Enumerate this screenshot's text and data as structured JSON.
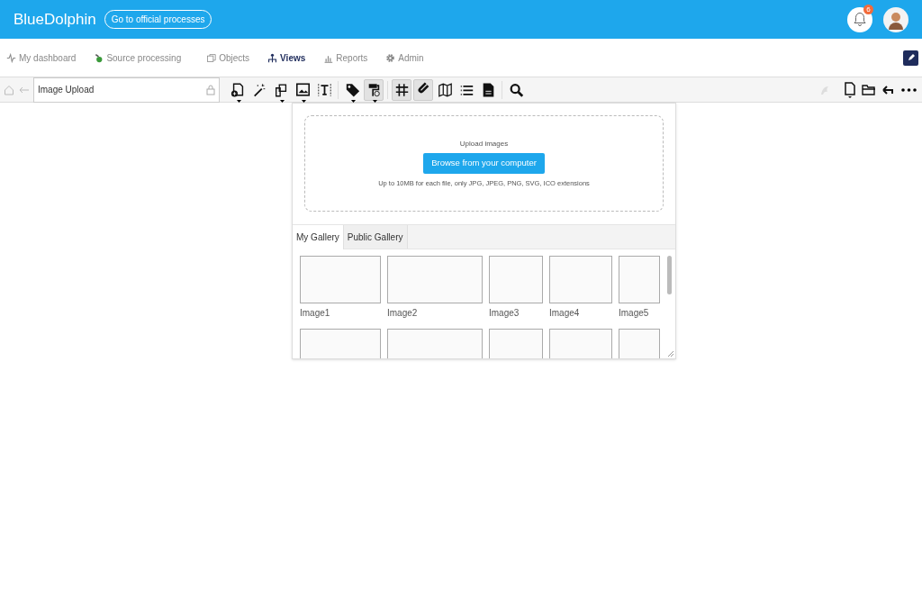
{
  "header": {
    "logo": "BlueDolphin",
    "process_link": "Go to official processes",
    "notification_count": "6"
  },
  "nav": [
    {
      "label": "My dashboard",
      "selected": false
    },
    {
      "label": "Source processing",
      "selected": false
    },
    {
      "label": "Objects",
      "selected": false
    },
    {
      "label": "Views",
      "selected": true
    },
    {
      "label": "Reports",
      "selected": false
    },
    {
      "label": "Admin",
      "selected": false
    }
  ],
  "toolbar": {
    "view_name": "Image Upload",
    "tools": [
      {
        "pressed": false
      },
      {
        "pressed": false
      },
      {
        "pressed": false
      },
      {
        "pressed": false
      },
      {
        "pressed": false
      },
      {
        "pressed": false
      },
      {
        "pressed": true
      },
      {
        "pressed": true
      },
      {
        "pressed": true
      },
      {
        "pressed": false
      },
      {
        "pressed": false
      },
      {
        "pressed": false
      },
      {
        "pressed": false
      }
    ]
  },
  "upload_panel": {
    "title": "Upload images",
    "button": "Browse from your computer",
    "hint": "Up to 10MB for each file, only JPG, JPEG, PNG, SVG, ICO extensions",
    "tabs": [
      {
        "label": "My Gallery",
        "selected": true
      },
      {
        "label": "Public Gallery",
        "selected": false
      }
    ],
    "images": [
      {
        "label": "Image1"
      },
      {
        "label": "Image2"
      },
      {
        "label": "Image3"
      },
      {
        "label": "Image4"
      },
      {
        "label": "Image5"
      }
    ]
  }
}
